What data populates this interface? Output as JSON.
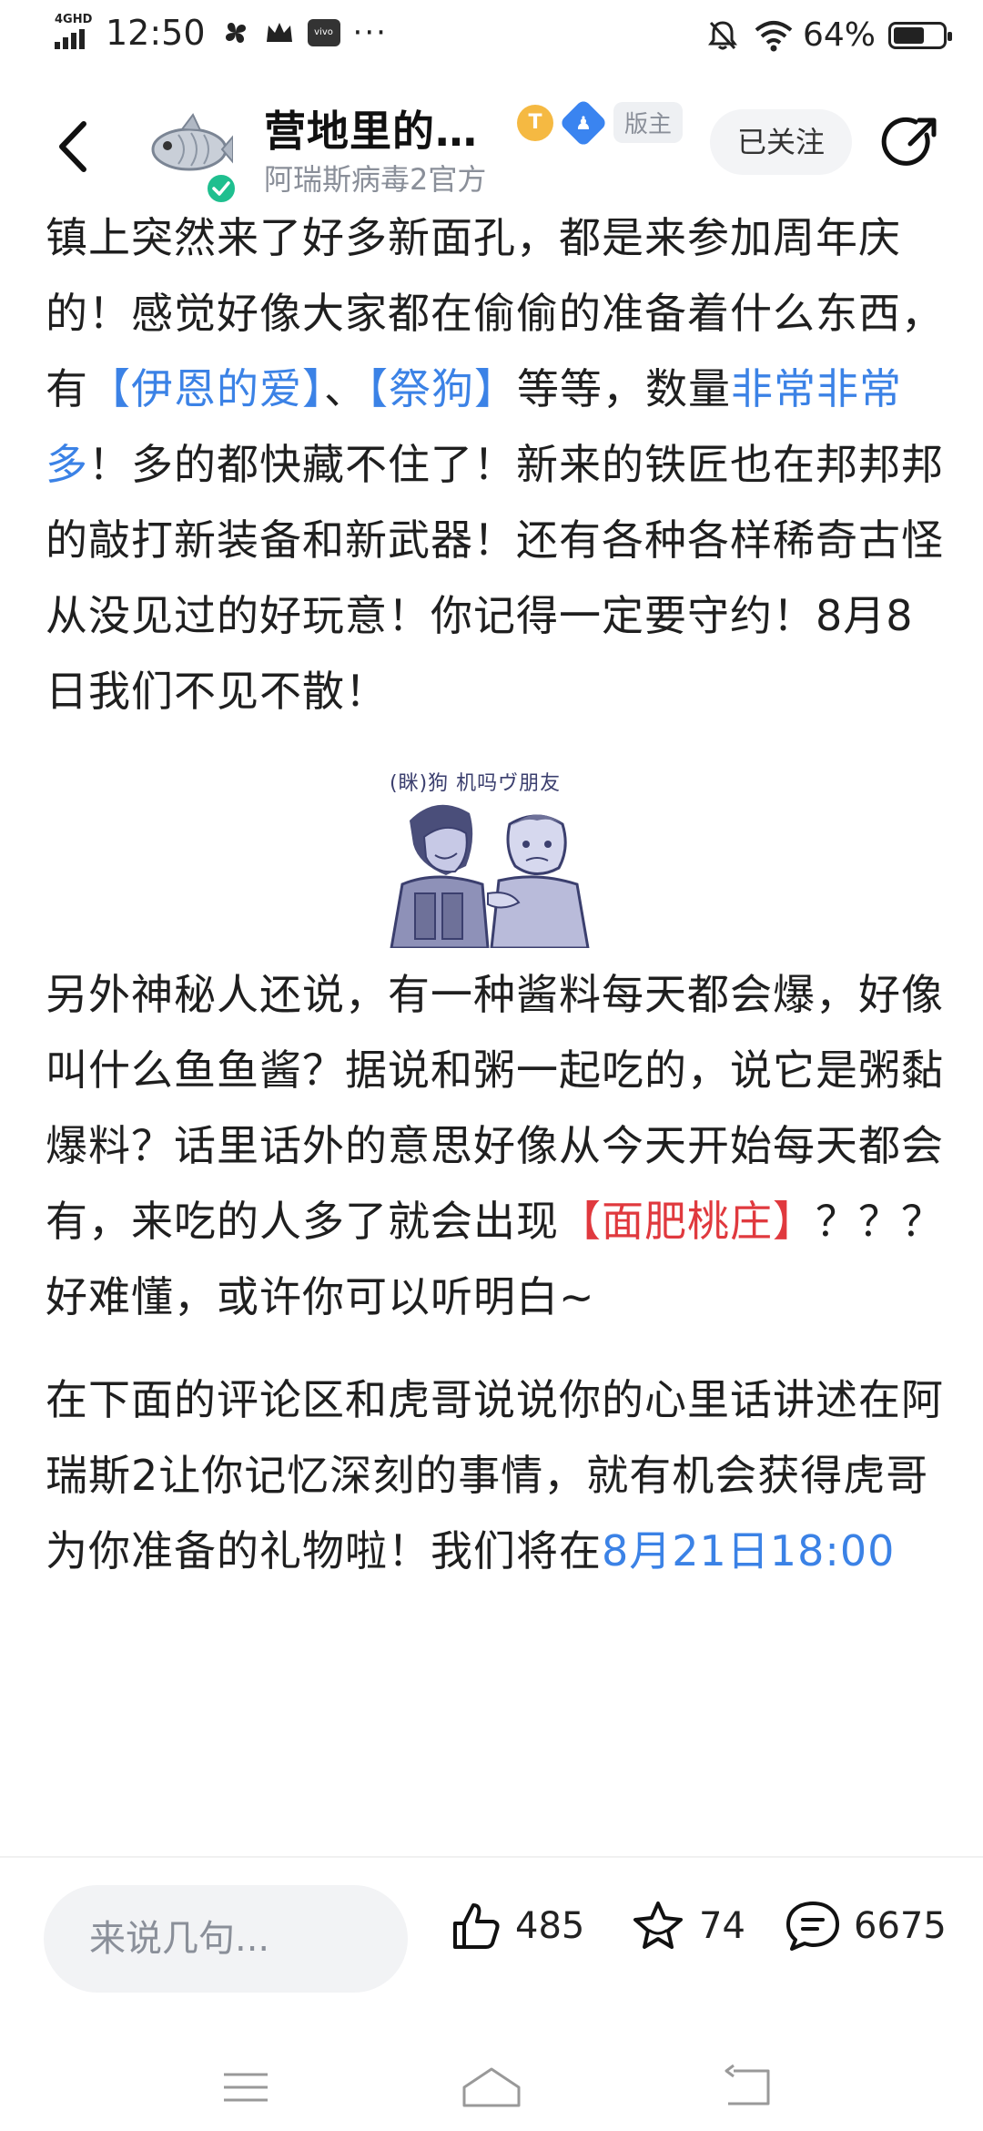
{
  "status": {
    "network": "4GHD",
    "time": "12:50",
    "dots": "···",
    "battery": "64%",
    "battery_level": 0.64
  },
  "header": {
    "forum_name": "营地里的…",
    "badge_t": "T",
    "badge_mod": "版主",
    "subtitle": "阿瑞斯病毒2官方",
    "follow_label": "已关注"
  },
  "post": {
    "p1": {
      "a": "镇上突然来了好多新面孔，都是来参加周年庆的！感觉好像大家都在偷偷的准备着什么东西，有",
      "link1": "【伊恩的爱】",
      "b": "、",
      "link2": "【祭狗】",
      "c": "等等，数量",
      "link3": "非常非常多",
      "d": "！多的都快藏不住了！新来的铁匠也在邦邦邦的敲打新装备和新武器！还有各种各样稀奇古怪从没见过的好玩意！你记得一定要守约！8月8日我们不见不散！"
    },
    "sticker_caption": "(眯)狗 机吗ヴ朋友",
    "p2": {
      "a": "另外神秘人还说，有一种酱料每天都会爆，好像叫什么鱼鱼酱？据说和粥一起吃的，说它是粥黏爆料？话里话外的意思好像从今天开始每天都会有，来吃的人多了就会出现",
      "highlight": "【面肥桃庄】",
      "b": "？？？好难懂，或许你可以听明白~"
    },
    "p3": {
      "a": "在下面的评论区和虎哥说说你的心里话讲述在阿瑞斯2让你记忆深刻的事情，就有机会获得虎哥为你准备的礼物啦！我们将在",
      "link": "8月21日18:00"
    }
  },
  "bottom": {
    "comment_placeholder": "来说几句...",
    "likes": "485",
    "favorites": "74",
    "comments": "6675"
  },
  "colors": {
    "link_blue": "#3b82e6",
    "highlight_red": "#e0393e"
  }
}
